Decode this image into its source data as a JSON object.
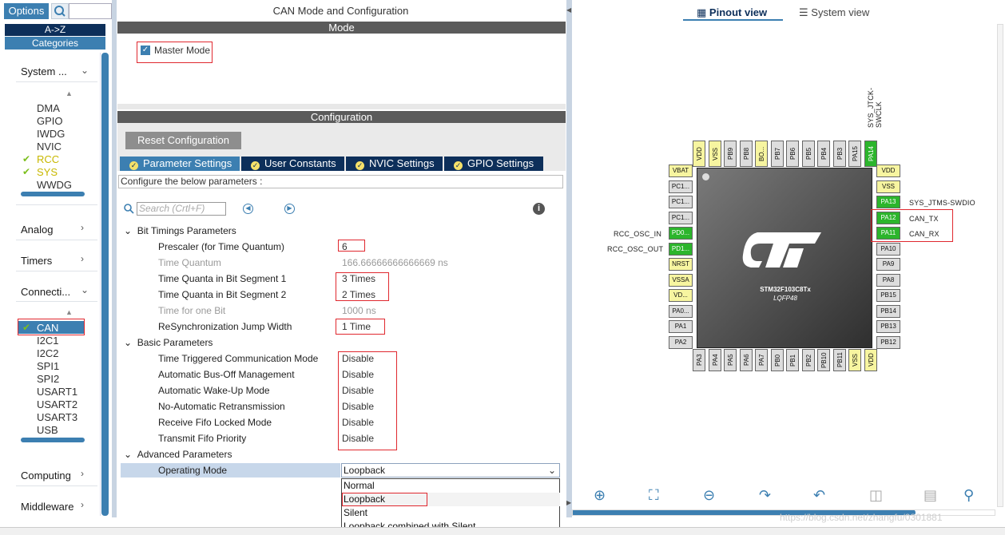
{
  "left": {
    "options_label": "Options",
    "az_label": "A->Z",
    "categories_label": "Categories",
    "sections": {
      "system": "System ...",
      "analog": "Analog",
      "timers": "Timers",
      "connectivity": "Connecti...",
      "computing": "Computing",
      "middleware": "Middleware"
    },
    "system_items": [
      "DMA",
      "GPIO",
      "IWDG",
      "NVIC",
      "RCC",
      "SYS",
      "WWDG"
    ],
    "conn_items": [
      "CAN",
      "I2C1",
      "I2C2",
      "SPI1",
      "SPI2",
      "USART1",
      "USART2",
      "USART3",
      "USB"
    ]
  },
  "mid": {
    "title": "CAN Mode and Configuration",
    "mode_header": "Mode",
    "master_mode": "Master Mode",
    "config_header": "Configuration",
    "reset_label": "Reset Configuration",
    "tabs": [
      "Parameter Settings",
      "User Constants",
      "NVIC Settings",
      "GPIO Settings"
    ],
    "configure_text": "Configure the below parameters :",
    "search_placeholder": "Search (Crtl+F)",
    "groups": {
      "bit": "Bit Timings Parameters",
      "basic": "Basic Parameters",
      "adv": "Advanced Parameters"
    },
    "params": [
      {
        "name": "Prescaler (for Time Quantum)",
        "value": "6"
      },
      {
        "name": "Time Quantum",
        "value": "166.66666666666669 ns"
      },
      {
        "name": "Time Quanta in Bit Segment 1",
        "value": "3 Times"
      },
      {
        "name": "Time Quanta in Bit Segment 2",
        "value": "2 Times"
      },
      {
        "name": "Time for one Bit",
        "value": "1000 ns"
      },
      {
        "name": "ReSynchronization Jump Width",
        "value": "1 Time"
      }
    ],
    "basic": [
      {
        "name": "Time Triggered Communication Mode",
        "value": "Disable"
      },
      {
        "name": "Automatic Bus-Off Management",
        "value": "Disable"
      },
      {
        "name": "Automatic Wake-Up Mode",
        "value": "Disable"
      },
      {
        "name": "No-Automatic Retransmission",
        "value": "Disable"
      },
      {
        "name": "Receive Fifo Locked Mode",
        "value": "Disable"
      },
      {
        "name": "Transmit Fifo Priority",
        "value": "Disable"
      }
    ],
    "op_mode": {
      "name": "Operating Mode",
      "value": "Loopback"
    },
    "dropdown": [
      "Normal",
      "Loopback",
      "Silent",
      "Loopback combined with Silent"
    ]
  },
  "right": {
    "pinout_view": "Pinout view",
    "system_view": "System view",
    "chip_name": "STM32F103C8Tx",
    "chip_pkg": "LQFP48",
    "top_pins": [
      "VDD",
      "VSS",
      "PB9",
      "PB8",
      "BO...",
      "PB7",
      "PB6",
      "PB5",
      "PB4",
      "PB3",
      "PA15",
      "PA14"
    ],
    "bottom_pins": [
      "PA3",
      "PA4",
      "PA5",
      "PA6",
      "PA7",
      "PB0",
      "PB1",
      "PB2",
      "PB10",
      "PB11",
      "VSS",
      "VDD"
    ],
    "left_pins": [
      "VBAT",
      "PC1...",
      "PC1...",
      "PC1...",
      "PD0...",
      "PD1...",
      "NRST",
      "VSSA",
      "VD...",
      "PA0...",
      "PA1",
      "PA2"
    ],
    "right_pins": [
      "VDD",
      "VSS",
      "PA13",
      "PA12",
      "PA11",
      "PA10",
      "PA9",
      "PA8",
      "PB15",
      "PB14",
      "PB13",
      "PB12"
    ],
    "labels": {
      "swclk": "SYS_JTCK-SWCLK",
      "swdio": "SYS_JTMS-SWDIO",
      "can_tx": "CAN_TX",
      "can_rx": "CAN_RX",
      "osc_in": "RCC_OSC_IN",
      "osc_out": "RCC_OSC_OUT"
    },
    "watermark": "https://blog.csdn.net/zhangfu/0301881"
  }
}
